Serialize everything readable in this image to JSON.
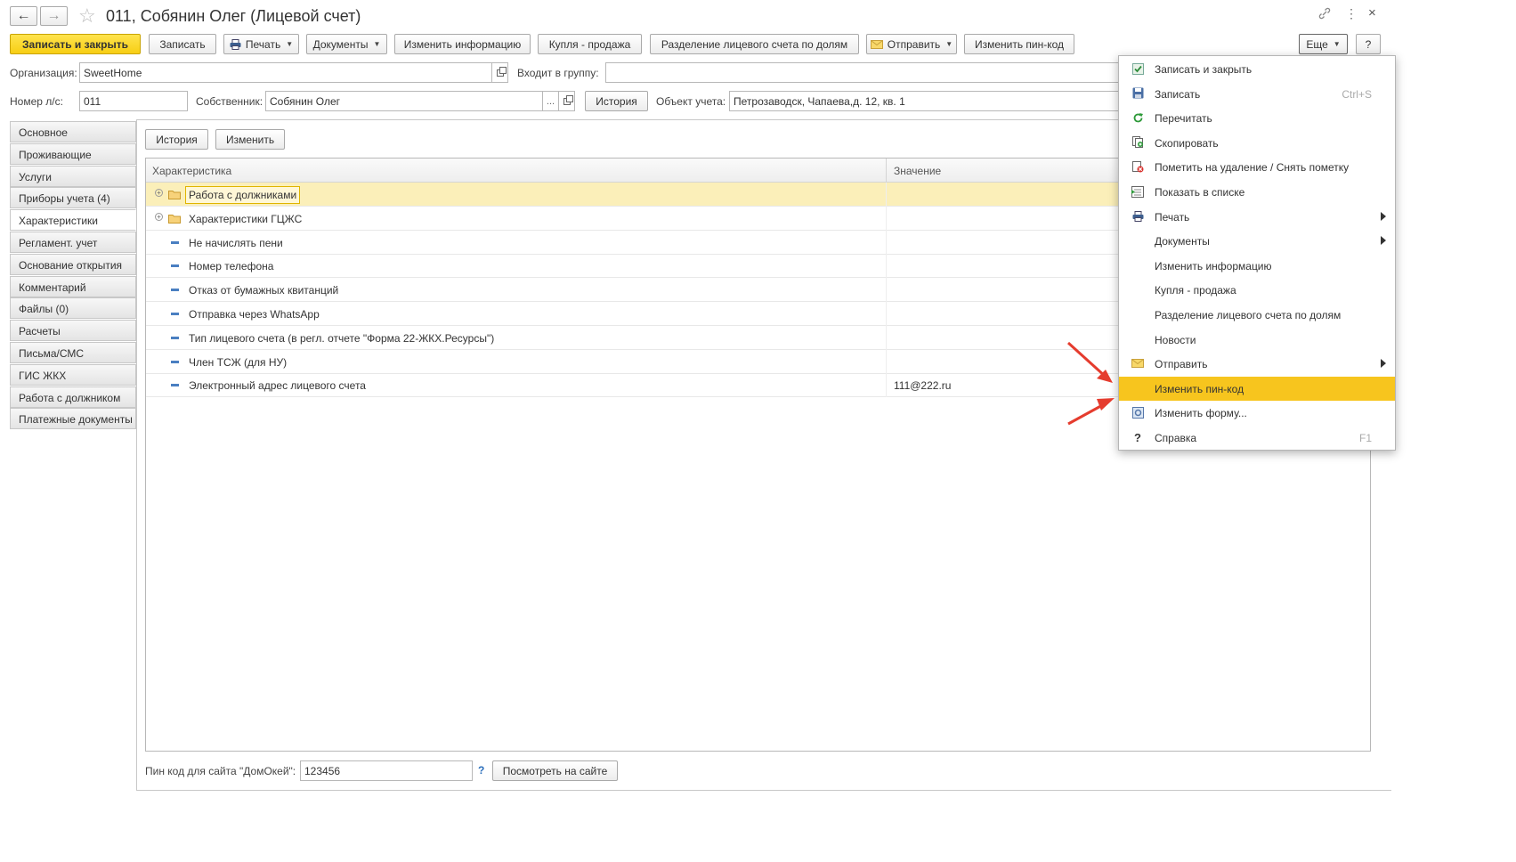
{
  "window": {
    "title": "011, Собянин Олег (Лицевой счет)"
  },
  "toolbar": {
    "save_close": "Записать и закрыть",
    "save": "Записать",
    "print": "Печать",
    "documents": "Документы",
    "change_info": "Изменить информацию",
    "buy_sell": "Купля - продажа",
    "split": "Разделение лицевого счета по долям",
    "send": "Отправить",
    "change_pin": "Изменить пин-код",
    "more": "Еще",
    "help": "?"
  },
  "form": {
    "org_label": "Организация:",
    "org_value": "SweetHome",
    "group_label": "Входит в группу:",
    "group_value": "",
    "account_label": "Номер л/с:",
    "account_value": "011",
    "owner_label": "Собственник:",
    "owner_value": "Собянин Олег",
    "owner_dots": "...",
    "history_button": "История",
    "object_label": "Объект учета:",
    "object_value": "Петрозаводск, Чапаева,д. 12, кв. 1"
  },
  "tabs": [
    {
      "label": "Основное",
      "active": false
    },
    {
      "label": "Проживающие",
      "active": false
    },
    {
      "label": "Услуги",
      "active": false
    },
    {
      "label": "Приборы учета (4)",
      "active": false
    },
    {
      "label": "Характеристики",
      "active": true
    },
    {
      "label": "Регламент. учет",
      "active": false
    },
    {
      "label": "Основание открытия",
      "active": false
    },
    {
      "label": "Комментарий",
      "active": false
    },
    {
      "label": "Файлы (0)",
      "active": false
    },
    {
      "label": "Расчеты",
      "active": false
    },
    {
      "label": "Письма/СМС",
      "active": false
    },
    {
      "label": "ГИС ЖКХ",
      "active": false
    },
    {
      "label": "Работа с должником",
      "active": false
    },
    {
      "label": "Платежные документы",
      "active": false
    }
  ],
  "panel": {
    "history": "История",
    "edit": "Изменить"
  },
  "table": {
    "col_name": "Характеристика",
    "col_value": "Значение",
    "rows": [
      {
        "name": "Работа с должниками",
        "value": "",
        "type": "folder",
        "selected": true
      },
      {
        "name": "Характеристики ГЦЖС",
        "value": "",
        "type": "folder",
        "selected": false
      },
      {
        "name": "Не начислять пени",
        "value": "",
        "type": "item",
        "selected": false
      },
      {
        "name": "Номер телефона",
        "value": "",
        "type": "item",
        "selected": false
      },
      {
        "name": "Отказ от бумажных квитанций",
        "value": "",
        "type": "item",
        "selected": false
      },
      {
        "name": "Отправка через WhatsApp",
        "value": "",
        "type": "item",
        "selected": false
      },
      {
        "name": "Тип лицевого счета (в регл. отчете \"Форма 22-ЖКХ.Ресурсы\")",
        "value": "",
        "type": "item",
        "selected": false
      },
      {
        "name": "Член ТСЖ (для НУ)",
        "value": "",
        "type": "item",
        "selected": false
      },
      {
        "name": "Электронный адрес лицевого счета",
        "value": "111@222.ru",
        "type": "item",
        "selected": false
      }
    ]
  },
  "footer": {
    "pin_label": "Пин код для сайта \"ДомОкей\":",
    "pin_value": "123456",
    "help": "?",
    "view_site": "Посмотреть на сайте"
  },
  "menu": {
    "items": [
      {
        "label": "Записать и закрыть",
        "shortcut": "",
        "submenu": false,
        "icon": "save-close-icon",
        "highlighted": false
      },
      {
        "label": "Записать",
        "shortcut": "Ctrl+S",
        "submenu": false,
        "icon": "save-disk-icon",
        "highlighted": false
      },
      {
        "label": "Перечитать",
        "shortcut": "",
        "submenu": false,
        "icon": "refresh-icon",
        "highlighted": false
      },
      {
        "label": "Скопировать",
        "shortcut": "",
        "submenu": false,
        "icon": "copy-icon",
        "highlighted": false
      },
      {
        "label": "Пометить на удаление / Снять пометку",
        "shortcut": "",
        "submenu": false,
        "icon": "mark-delete-icon",
        "highlighted": false
      },
      {
        "label": "Показать в списке",
        "shortcut": "",
        "submenu": false,
        "icon": "show-in-list-icon",
        "highlighted": false
      },
      {
        "label": "Печать",
        "shortcut": "",
        "submenu": true,
        "icon": "printer-icon",
        "highlighted": false
      },
      {
        "label": "Документы",
        "shortcut": "",
        "submenu": true,
        "icon": "",
        "highlighted": false
      },
      {
        "label": "Изменить информацию",
        "shortcut": "",
        "submenu": false,
        "icon": "",
        "highlighted": false
      },
      {
        "label": "Купля - продажа",
        "shortcut": "",
        "submenu": false,
        "icon": "",
        "highlighted": false
      },
      {
        "label": "Разделение лицевого счета по долям",
        "shortcut": "",
        "submenu": false,
        "icon": "",
        "highlighted": false
      },
      {
        "label": "Новости",
        "shortcut": "",
        "submenu": false,
        "icon": "",
        "highlighted": false
      },
      {
        "label": "Отправить",
        "shortcut": "",
        "submenu": true,
        "icon": "envelope-icon",
        "highlighted": false
      },
      {
        "label": "Изменить пин-код",
        "shortcut": "",
        "submenu": false,
        "icon": "",
        "highlighted": true
      },
      {
        "label": "Изменить форму...",
        "shortcut": "",
        "submenu": false,
        "icon": "form-settings-icon",
        "highlighted": false
      },
      {
        "label": "Справка",
        "shortcut": "F1",
        "submenu": false,
        "icon": "help-question-icon",
        "highlighted": false
      }
    ]
  },
  "colors": {
    "accent_yellow": "#f7ce14",
    "selection": "#fbefb9",
    "annotation_arrow": "#e53c2e"
  }
}
